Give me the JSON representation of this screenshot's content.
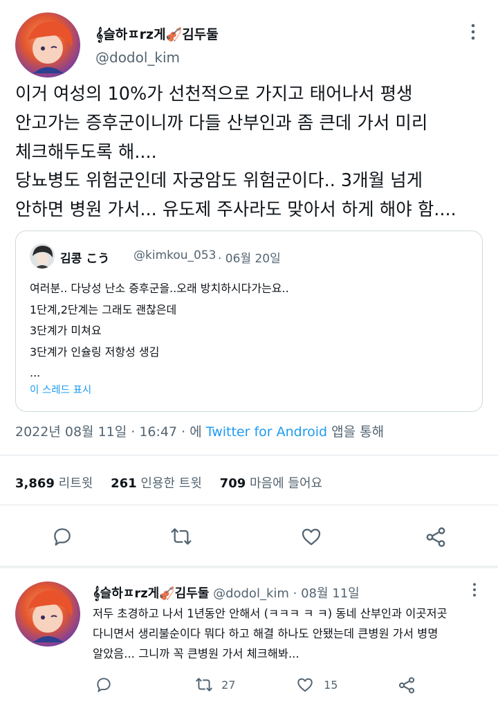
{
  "tweet": {
    "display_name": "𝄞슬하ㅍrz게🎻김두둘",
    "handle": "@dodol_kim",
    "body_lines": [
      "이거 여성의 10%가 선천적으로 가지고 태어나서 평생",
      "안고가는 증후군이니까 다들 산부인과 좀 큰데 가서 미리",
      "체크해두도록 해....",
      "당뇨병도 위험군인데 자궁암도 위험군이다.. 3개월 넘게",
      "안하면 병원 가서... 유도제 주사라도 맞아서 하게 해야 함...."
    ],
    "quote": {
      "name": "김콩 こう",
      "handle": "@kimkou_053",
      "date": "· 06월 20일",
      "lines": [
        "여러분.. 다낭성 난소 증후군을..오래 방치하시다가는요..",
        "1단계,2단계는 그래도 괜찮은데",
        "3단계가 미쳐요",
        "3단계가 인슐링 저항성 생김",
        "..."
      ],
      "show_thread": "이 스레드 표시"
    },
    "meta": {
      "datetime": "2022년 08월 11일 · 16:47 · 에",
      "source": "Twitter for Android",
      "suffix": "앱을 통해"
    },
    "stats": {
      "retweets": "3,869",
      "retweets_label": "리트윗",
      "quotes": "261",
      "quotes_label": "인용한 트윗",
      "likes": "709",
      "likes_label": "마음에 들어요"
    }
  },
  "reply": {
    "display_name": "𝄞슬하ㅍrz게🎻김두둘",
    "handle": "@dodol_kim",
    "date": "· 08월 11일",
    "lines": [
      "저두 초경하고 나서 1년동안 안해서 (ㅋㅋㅋ ㅋ ㅋ) 동네 산부인과 이곳저곳",
      "다니면서 생리불순이다 뭐다 하고 해결 하나도 안됐는데 큰병원 가서 병명",
      "알았음... 그니까 꼭 큰병원 가서 체크해봐..."
    ],
    "retweet_count": "27",
    "like_count": "15"
  },
  "icons": {
    "more": "more-dots-icon",
    "reply": "reply-bubble-icon",
    "retweet": "retweet-arrows-icon",
    "like": "heart-icon",
    "share": "share-icon"
  },
  "colors": {
    "text": "#0f1419",
    "muted": "#536471",
    "link": "#1d9bf0",
    "divider": "#e1e6ea",
    "icon": "#536471"
  }
}
